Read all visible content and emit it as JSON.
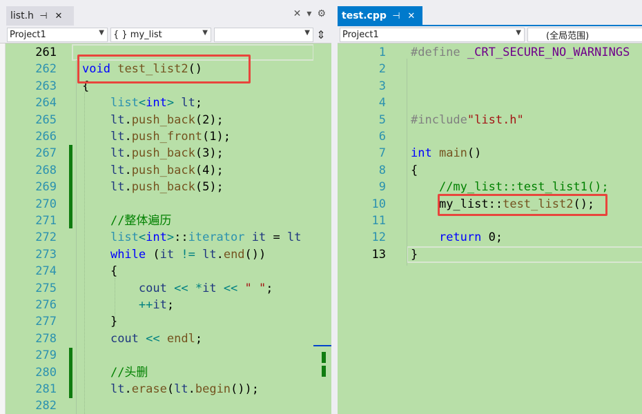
{
  "left": {
    "tab": {
      "title": "list.h",
      "pin": "⊣",
      "close": "✕"
    },
    "tools": {
      "close_all": "✕",
      "dropdown": "▾",
      "settings": "⚙"
    },
    "nav": {
      "project": "Project1",
      "scope": "{ } my_list",
      "member": "",
      "split": "⇕"
    },
    "lines": [
      {
        "n": "261",
        "code": []
      },
      {
        "n": "262",
        "code": [
          [
            "kw",
            "void"
          ],
          [
            "tx",
            " "
          ],
          [
            "fn",
            "test_list2"
          ],
          [
            "tx",
            "()"
          ]
        ]
      },
      {
        "n": "263",
        "code": [
          [
            "tx",
            "{"
          ]
        ]
      },
      {
        "n": "264",
        "code": [
          [
            "tx",
            "    "
          ],
          [
            "ty",
            "list"
          ],
          [
            "op",
            "<"
          ],
          [
            "kw",
            "int"
          ],
          [
            "op",
            ">"
          ],
          [
            "tx",
            " "
          ],
          [
            "vr",
            "lt"
          ],
          [
            "tx",
            ";"
          ]
        ]
      },
      {
        "n": "265",
        "code": [
          [
            "tx",
            "    "
          ],
          [
            "vr",
            "lt"
          ],
          [
            "tx",
            "."
          ],
          [
            "fn",
            "push_back"
          ],
          [
            "tx",
            "("
          ],
          [
            "nm",
            "2"
          ],
          [
            "tx",
            ");"
          ]
        ]
      },
      {
        "n": "266",
        "code": [
          [
            "tx",
            "    "
          ],
          [
            "vr",
            "lt"
          ],
          [
            "tx",
            "."
          ],
          [
            "fn",
            "push_front"
          ],
          [
            "tx",
            "("
          ],
          [
            "nm",
            "1"
          ],
          [
            "tx",
            ");"
          ]
        ]
      },
      {
        "n": "267",
        "code": [
          [
            "tx",
            "    "
          ],
          [
            "vr",
            "lt"
          ],
          [
            "tx",
            "."
          ],
          [
            "fn",
            "push_back"
          ],
          [
            "tx",
            "("
          ],
          [
            "nm",
            "3"
          ],
          [
            "tx",
            ");"
          ]
        ]
      },
      {
        "n": "268",
        "code": [
          [
            "tx",
            "    "
          ],
          [
            "vr",
            "lt"
          ],
          [
            "tx",
            "."
          ],
          [
            "fn",
            "push_back"
          ],
          [
            "tx",
            "("
          ],
          [
            "nm",
            "4"
          ],
          [
            "tx",
            ");"
          ]
        ]
      },
      {
        "n": "269",
        "code": [
          [
            "tx",
            "    "
          ],
          [
            "vr",
            "lt"
          ],
          [
            "tx",
            "."
          ],
          [
            "fn",
            "push_back"
          ],
          [
            "tx",
            "("
          ],
          [
            "nm",
            "5"
          ],
          [
            "tx",
            ");"
          ]
        ]
      },
      {
        "n": "270",
        "code": []
      },
      {
        "n": "271",
        "code": [
          [
            "tx",
            "    "
          ],
          [
            "cm",
            "//整体遍历"
          ]
        ]
      },
      {
        "n": "272",
        "code": [
          [
            "tx",
            "    "
          ],
          [
            "ty",
            "list"
          ],
          [
            "op",
            "<"
          ],
          [
            "kw",
            "int"
          ],
          [
            "op",
            ">"
          ],
          [
            "tx",
            "::"
          ],
          [
            "ty",
            "iterator"
          ],
          [
            "tx",
            " "
          ],
          [
            "vr",
            "it"
          ],
          [
            "tx",
            " = "
          ],
          [
            "vr",
            "lt"
          ]
        ]
      },
      {
        "n": "273",
        "code": [
          [
            "tx",
            "    "
          ],
          [
            "kw",
            "while"
          ],
          [
            "tx",
            " ("
          ],
          [
            "vr",
            "it"
          ],
          [
            "tx",
            " "
          ],
          [
            "op",
            "!="
          ],
          [
            "tx",
            " "
          ],
          [
            "vr",
            "lt"
          ],
          [
            "tx",
            "."
          ],
          [
            "fn",
            "end"
          ],
          [
            "tx",
            "())"
          ]
        ]
      },
      {
        "n": "274",
        "code": [
          [
            "tx",
            "    {"
          ]
        ]
      },
      {
        "n": "275",
        "code": [
          [
            "tx",
            "        "
          ],
          [
            "vr",
            "cout"
          ],
          [
            "tx",
            " "
          ],
          [
            "op",
            "<<"
          ],
          [
            "tx",
            " "
          ],
          [
            "op",
            "*"
          ],
          [
            "vr",
            "it"
          ],
          [
            "tx",
            " "
          ],
          [
            "op",
            "<<"
          ],
          [
            "tx",
            " "
          ],
          [
            "st",
            "\" \""
          ],
          [
            "tx",
            ";"
          ]
        ]
      },
      {
        "n": "276",
        "code": [
          [
            "tx",
            "        "
          ],
          [
            "op",
            "++"
          ],
          [
            "vr",
            "it"
          ],
          [
            "tx",
            ";"
          ]
        ]
      },
      {
        "n": "277",
        "code": [
          [
            "tx",
            "    }"
          ]
        ]
      },
      {
        "n": "278",
        "code": [
          [
            "tx",
            "    "
          ],
          [
            "vr",
            "cout"
          ],
          [
            "tx",
            " "
          ],
          [
            "op",
            "<<"
          ],
          [
            "tx",
            " "
          ],
          [
            "fn",
            "endl"
          ],
          [
            "tx",
            ";"
          ]
        ]
      },
      {
        "n": "279",
        "code": []
      },
      {
        "n": "280",
        "code": [
          [
            "tx",
            "    "
          ],
          [
            "cm",
            "//头删"
          ]
        ]
      },
      {
        "n": "281",
        "code": [
          [
            "tx",
            "    "
          ],
          [
            "vr",
            "lt"
          ],
          [
            "tx",
            "."
          ],
          [
            "fn",
            "erase"
          ],
          [
            "tx",
            "("
          ],
          [
            "vr",
            "lt"
          ],
          [
            "tx",
            "."
          ],
          [
            "fn",
            "begin"
          ],
          [
            "tx",
            "());"
          ]
        ]
      },
      {
        "n": "282",
        "code": []
      }
    ]
  },
  "right": {
    "tab": {
      "title": "test.cpp",
      "pin": "⊣",
      "close": "✕"
    },
    "nav": {
      "project": "Project1",
      "scope": "(全局范围)"
    },
    "lines": [
      {
        "n": "1",
        "code": [
          [
            "pp",
            "#define"
          ],
          [
            "tx",
            " "
          ],
          [
            "mc",
            "_CRT_SECURE_NO_WARNINGS"
          ]
        ]
      },
      {
        "n": "2",
        "code": []
      },
      {
        "n": "3",
        "code": []
      },
      {
        "n": "4",
        "code": []
      },
      {
        "n": "5",
        "code": [
          [
            "pp",
            "#include"
          ],
          [
            "st",
            "\"list.h\""
          ]
        ]
      },
      {
        "n": "6",
        "code": []
      },
      {
        "n": "7",
        "code": [
          [
            "kw",
            "int"
          ],
          [
            "tx",
            " "
          ],
          [
            "fn",
            "main"
          ],
          [
            "tx",
            "()"
          ]
        ]
      },
      {
        "n": "8",
        "code": [
          [
            "tx",
            "{"
          ]
        ]
      },
      {
        "n": "9",
        "code": [
          [
            "tx",
            "    "
          ],
          [
            "cm",
            "//my_list::test_list1();"
          ]
        ]
      },
      {
        "n": "10",
        "code": [
          [
            "tx",
            "    "
          ],
          [
            "tx",
            "my_list"
          ],
          [
            "tx",
            "::"
          ],
          [
            "fn",
            "test_list2"
          ],
          [
            "tx",
            "();"
          ]
        ]
      },
      {
        "n": "11",
        "code": []
      },
      {
        "n": "12",
        "code": [
          [
            "tx",
            "    "
          ],
          [
            "kw",
            "return"
          ],
          [
            "tx",
            " "
          ],
          [
            "nm",
            "0"
          ],
          [
            "tx",
            ";"
          ]
        ]
      },
      {
        "n": "13",
        "code": [
          [
            "tx",
            "}"
          ]
        ]
      }
    ]
  },
  "colors": {
    "editor_bg": "#b8dfa8",
    "accent_blue": "#007acc",
    "highlight_red": "#e8453c",
    "change_green": "#107c10"
  }
}
